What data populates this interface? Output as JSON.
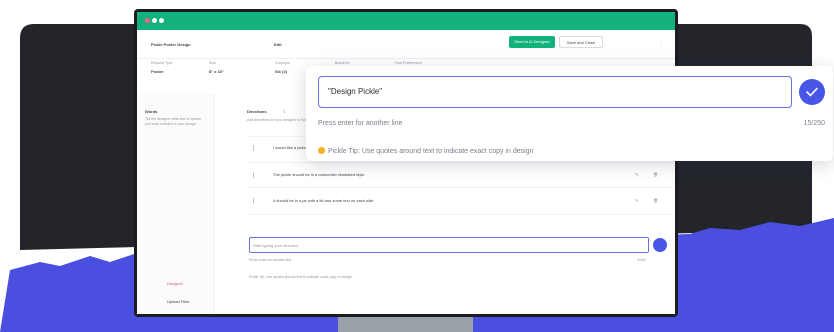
{
  "app": {
    "project_name": "Pickle Poster Design",
    "status": "Edit",
    "primary_button": "Send to AI Designer",
    "secondary_button": "Save and Close",
    "filters": [
      {
        "label": "Request Type",
        "value": "Poster"
      },
      {
        "label": "Size",
        "value": "8\" x 10\""
      },
      {
        "label": "Concepts",
        "value": "Six (2)"
      },
      {
        "label": "Brand Kit",
        "value": ""
      },
      {
        "label": "Font Preferences",
        "value": ""
      }
    ]
  },
  "sidebar": {
    "title": "Words",
    "description": "Tell the designer what text or quotes you want included in your design.",
    "nav": [
      "Designer",
      "Upload Files"
    ]
  },
  "main": {
    "section_title": "Directions",
    "section_count": "3",
    "section_sub": "Add directions for your designer to follow",
    "directions": [
      "I would like a pickle in a bright color",
      "The pickle should be in a cartoonish illustrated style",
      "It should be in a jar with a lid and some text on each side"
    ],
    "input_placeholder": "Start typing your direction",
    "hint": "Press enter for another line",
    "counter": "0/250",
    "tip": "Pickle Tip: Use quotes around text to indicate exact copy in design"
  },
  "popup": {
    "input_value": "\"Design Pickle\"",
    "hint": "Press enter for another line",
    "counter": "15/250",
    "tip": "Pickle Tip: Use quotes around text to indicate exact copy in design"
  },
  "colors": {
    "accent_green": "#13b27c",
    "accent_blue": "#4856e8",
    "backdrop_dark": "#23252b"
  }
}
